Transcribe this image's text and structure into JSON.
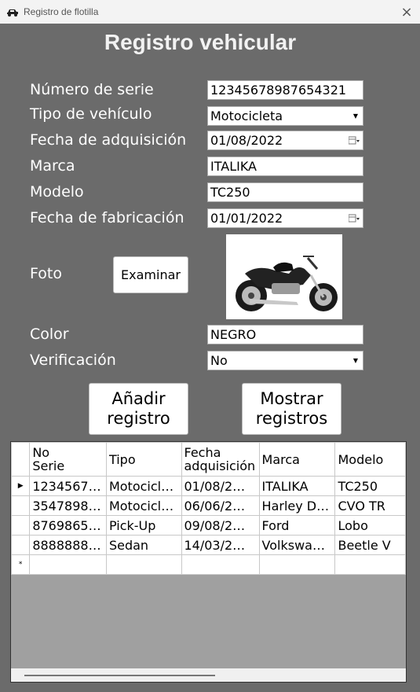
{
  "window": {
    "title": "Registro de flotilla",
    "close_icon": "×"
  },
  "form": {
    "heading": "Registro vehicular",
    "labels": {
      "serie": "Número de serie",
      "tipo": "Tipo de vehículo",
      "fecha_adq": "Fecha de adquisición",
      "marca": "Marca",
      "modelo": "Modelo",
      "fecha_fab": "Fecha de fabricación",
      "foto": "Foto",
      "color": "Color",
      "verificacion": "Verificación"
    },
    "values": {
      "serie": "12345678987654321",
      "tipo": "Motocicleta",
      "fecha_adq": "01/08/2022",
      "marca": "ITALIKA",
      "modelo": "TC250",
      "fecha_fab": "01/01/2022",
      "color": "NEGRO",
      "verificacion": "No"
    },
    "examinar_label": "Examinar",
    "add_label_1": "Añadir",
    "add_label_2": "registro",
    "show_label_1": "Mostrar",
    "show_label_2": "registros"
  },
  "grid": {
    "headers": [
      "No\nSerie",
      "Tipo",
      "Fecha\nadquisición",
      "Marca",
      "Modelo"
    ],
    "rows": [
      [
        "1234567…",
        "Motocicl…",
        "01/08/2…",
        "ITALIKA",
        "TC250"
      ],
      [
        "3547898…",
        "Motocicl…",
        "06/06/2…",
        "Harley D…",
        "CVO TR"
      ],
      [
        "8769865…",
        "Pick-Up",
        "09/08/2…",
        "Ford",
        "Lobo"
      ],
      [
        "8888888…",
        "Sedan",
        "14/03/2…",
        "Volkswa…",
        "Beetle V"
      ]
    ],
    "current_row_marker": "▶",
    "new_row_marker": "*"
  },
  "colors": {
    "form_bg": "#6b6b6b",
    "grid_bg": "#a0a0a0"
  },
  "icons": {
    "app": "car-icon",
    "calendar": "calendar-icon",
    "dropdown": "dropdown-arrow-icon"
  }
}
